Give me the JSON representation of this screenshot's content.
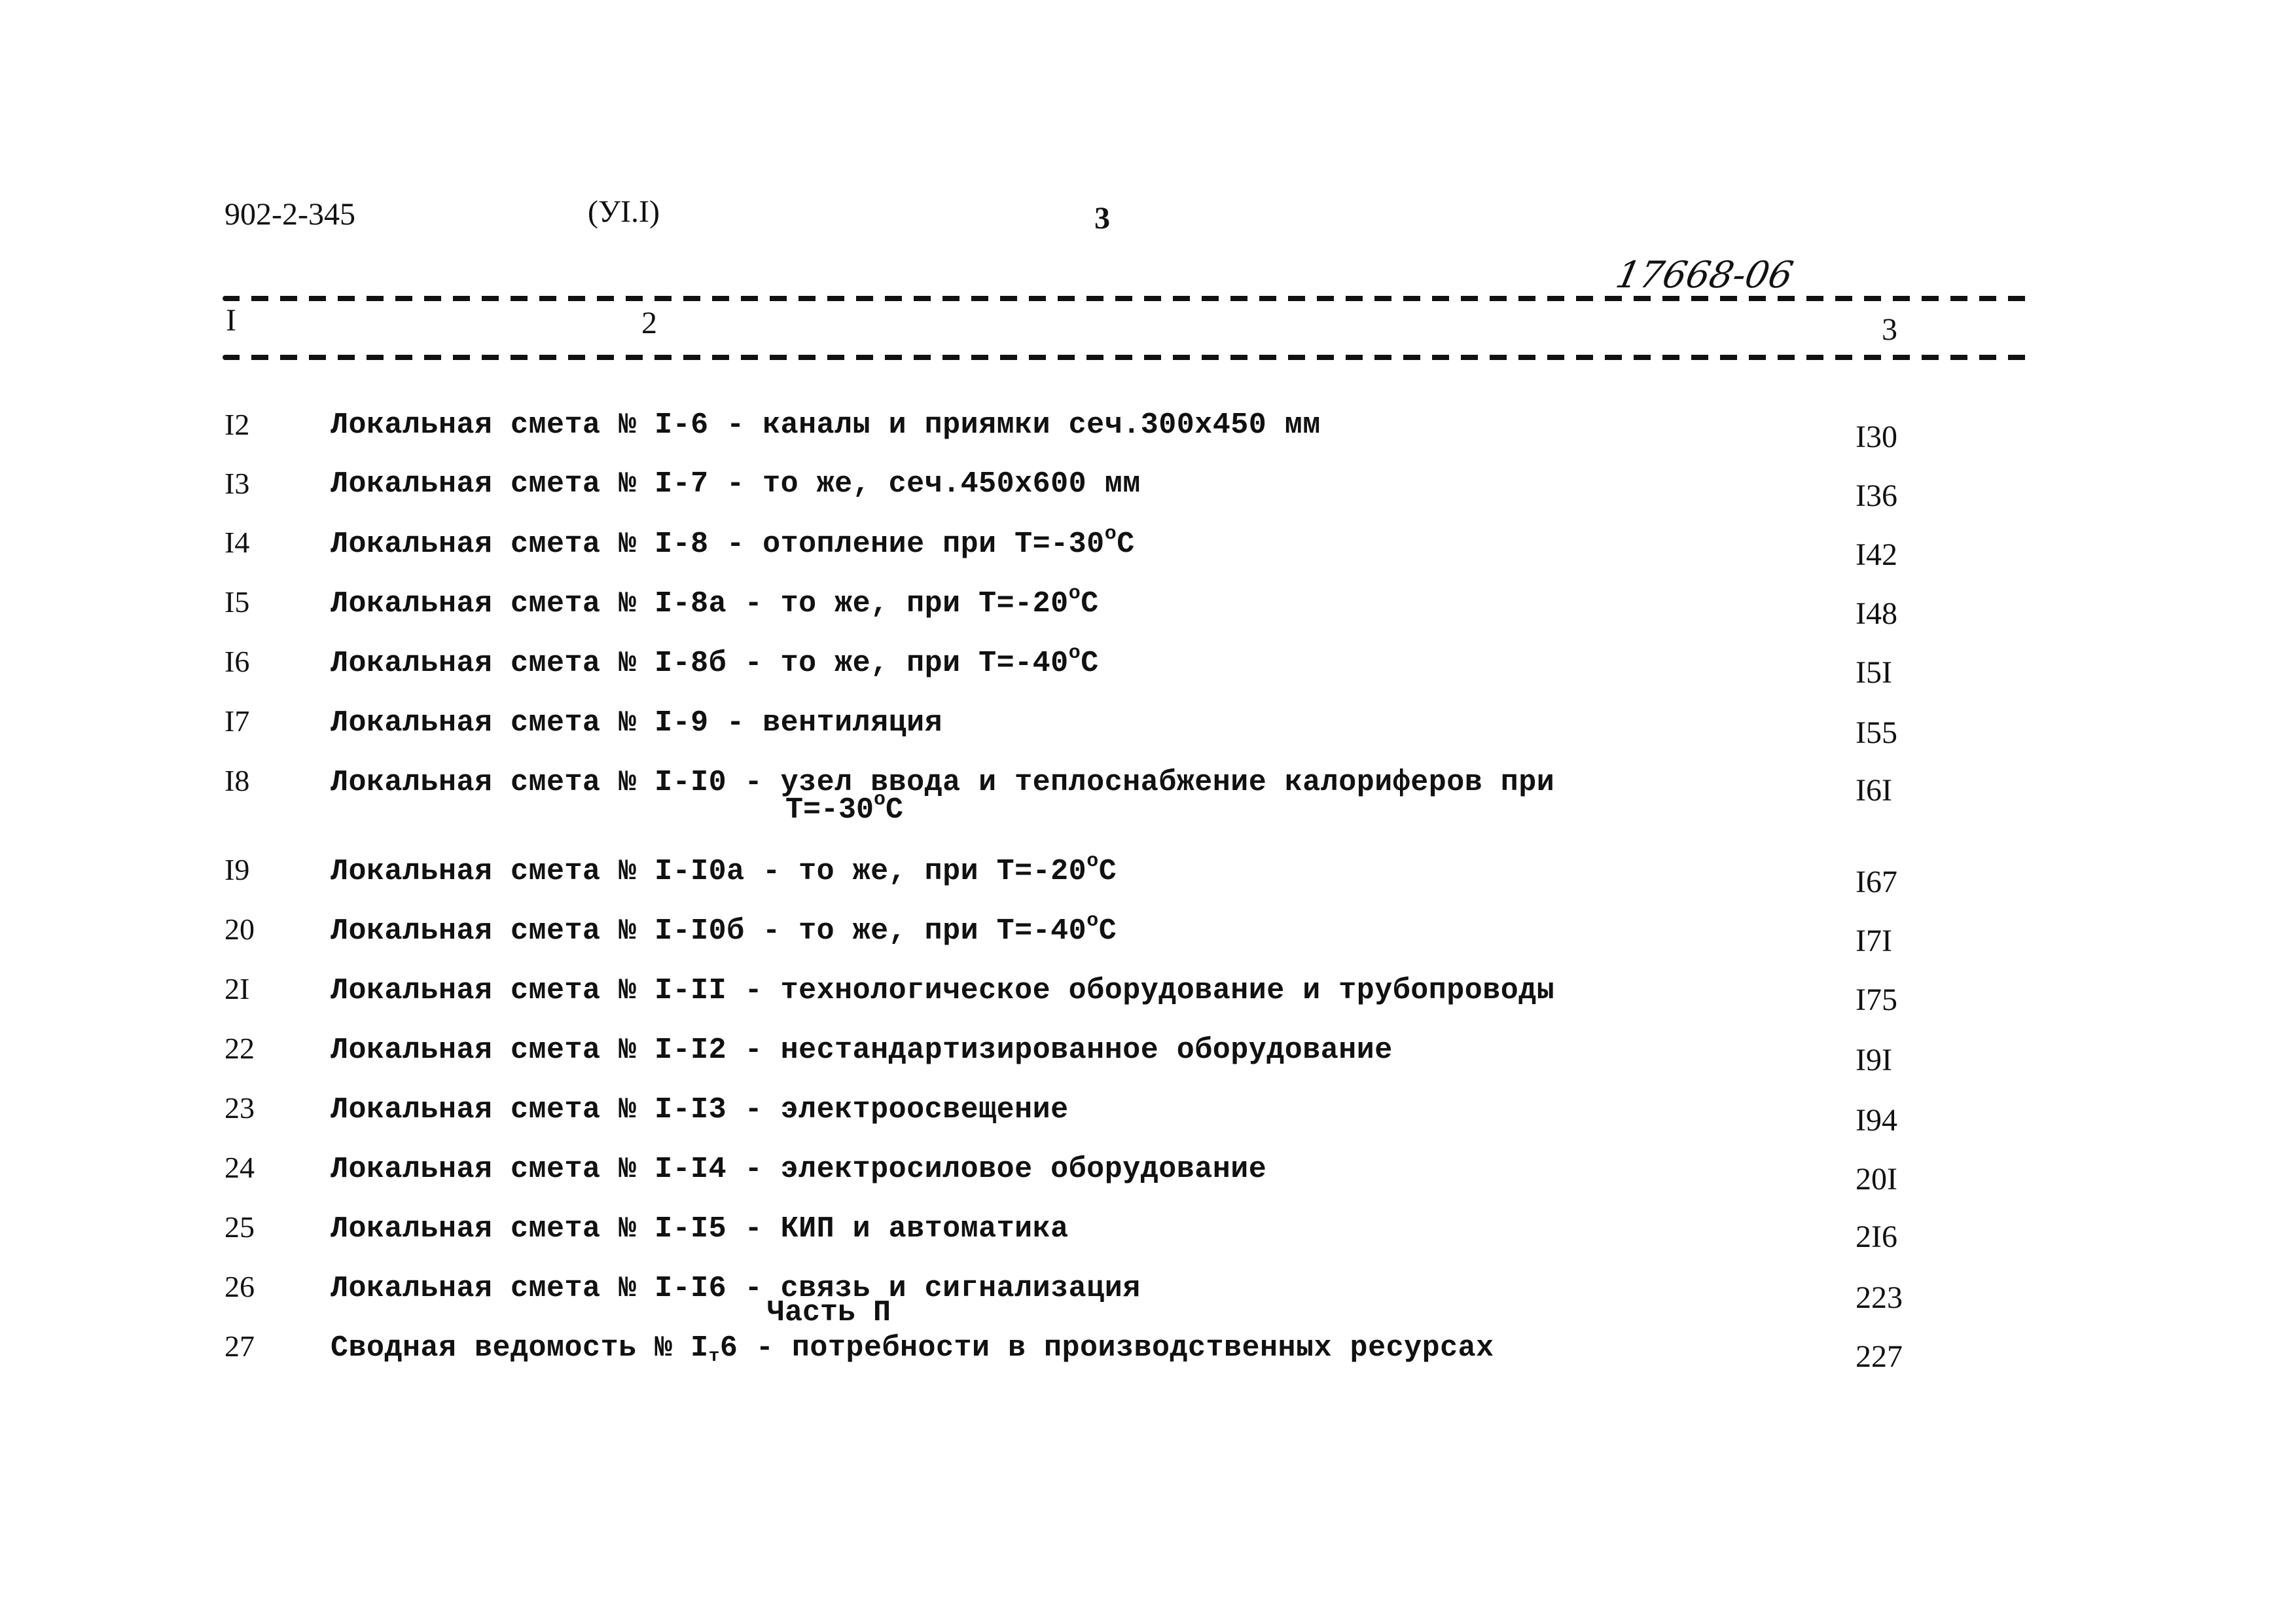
{
  "header": {
    "doc_code": "902-2-345",
    "volume": "(УI.I)",
    "page_number": "3",
    "handwritten_ref": "17668-06"
  },
  "columns": [
    "I",
    "2",
    "3"
  ],
  "rows": [
    {
      "num": "I2",
      "text": "Локальная смета № I-6 - каналы и приямки сеч.300х450 мм",
      "page": "I30"
    },
    {
      "num": "I3",
      "text": "Локальная смета № I-7 - то же, сеч.450х600 мм",
      "page": "I36"
    },
    {
      "num": "I4",
      "text": "Локальная смета № I-8 - отопление при Т=-30",
      "deg": "о",
      "tail": "С",
      "page": "I42"
    },
    {
      "num": "I5",
      "text": "Локальная смета № I-8а - то же, при Т=-20",
      "deg": "о",
      "tail": "С",
      "page": "I48"
    },
    {
      "num": "I6",
      "text": "Локальная смета № I-8б - то же, при Т=-40",
      "deg": "о",
      "tail": "С",
      "page": "I5I"
    },
    {
      "num": "I7",
      "text": "Локальная смета № I-9 - вентиляция",
      "page": "I55"
    },
    {
      "num": "I8",
      "text": "Локальная смета № I-I0 - узел ввода и теплоснабжение калориферов при",
      "cont": "Т=-30",
      "cont_deg": "о",
      "cont_tail": "С",
      "page": "I6I"
    },
    {
      "num": "I9",
      "text": "Локальная смета № I-I0а - то же, при Т=-20",
      "deg": "о",
      "tail": "С",
      "page": "I67"
    },
    {
      "num": "20",
      "text": "Локальная смета № I-I0б - то же, при Т=-40",
      "deg": "о",
      "tail": "С",
      "page": "I7I"
    },
    {
      "num": "2I",
      "text": "Локальная смета № I-II - технологическое оборудование и трубопроводы",
      "page": "I75"
    },
    {
      "num": "22",
      "text": "Локальная смета № I-I2 - нестандартизированное оборудование",
      "page": "I9I"
    },
    {
      "num": "23",
      "text": "Локальная смета № I-I3 - электроосвещение",
      "page": "I94"
    },
    {
      "num": "24",
      "text": "Локальная смета № I-I4 - электросиловое оборудование",
      "page": "20I"
    },
    {
      "num": "25",
      "text": "Локальная смета № I-I5 - КИП и автоматика",
      "page": "2I6"
    },
    {
      "num": "26",
      "text": "Локальная смета № I-I6 - связь и сигнализация",
      "page": "223"
    },
    {
      "num": "27",
      "text_a": "Сводная ведомость № I",
      "sub": "т",
      "text_b": "6 - потребности в производственных ресурсах",
      "page": "227"
    }
  ],
  "section_label": "Часть П"
}
